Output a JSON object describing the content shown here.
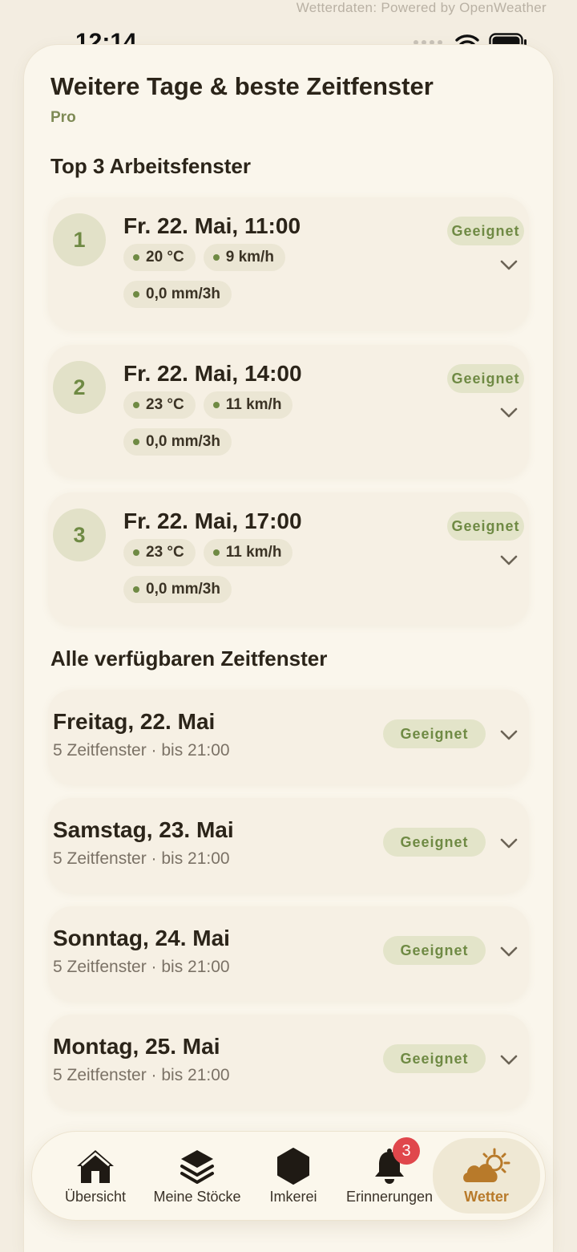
{
  "attribution": "Wetterdaten: Powered by OpenWeather",
  "status_bar": {
    "time": "12:14"
  },
  "sheet": {
    "title": "Weitere Tage & beste Zeitfenster",
    "subtitle": "Pro",
    "top_heading": "Top 3 Arbeitsfenster",
    "all_heading": "Alle verfügbaren Zeitfenster"
  },
  "top_windows": [
    {
      "rank": "1",
      "title": "Fr. 22. Mai, 11:00",
      "temp": "20 °C",
      "wind": "9 km/h",
      "rain": "0,0 mm/3h",
      "badge": "Geeignet"
    },
    {
      "rank": "2",
      "title": "Fr. 22. Mai, 14:00",
      "temp": "23 °C",
      "wind": "11 km/h",
      "rain": "0,0 mm/3h",
      "badge": "Geeignet"
    },
    {
      "rank": "3",
      "title": "Fr. 22. Mai, 17:00",
      "temp": "23 °C",
      "wind": "11 km/h",
      "rain": "0,0 mm/3h",
      "badge": "Geeignet"
    }
  ],
  "days": [
    {
      "title": "Freitag, 22. Mai",
      "subtitle": "5 Zeitfenster · bis 21:00",
      "badge": "Geeignet"
    },
    {
      "title": "Samstag, 23. Mai",
      "subtitle": "5 Zeitfenster · bis 21:00",
      "badge": "Geeignet"
    },
    {
      "title": "Sonntag, 24. Mai",
      "subtitle": "5 Zeitfenster · bis 21:00",
      "badge": "Geeignet"
    },
    {
      "title": "Montag, 25. Mai",
      "subtitle": "5 Zeitfenster · bis 21:00",
      "badge": "Geeignet"
    }
  ],
  "tabbar": {
    "items": [
      {
        "label": "Übersicht",
        "icon": "home-icon"
      },
      {
        "label": "Meine Stöcke",
        "icon": "layers-icon"
      },
      {
        "label": "Imkerei",
        "icon": "hexagon-icon"
      },
      {
        "label": "Erinnerungen",
        "icon": "bell-icon",
        "badge": "3"
      },
      {
        "label": "Wetter",
        "icon": "weather-icon",
        "active": true
      }
    ]
  },
  "colors": {
    "accent_green": "#6f8a44",
    "accent_orange": "#b87a2a",
    "badge_red": "#e0474c",
    "background": "#f3ede1"
  }
}
